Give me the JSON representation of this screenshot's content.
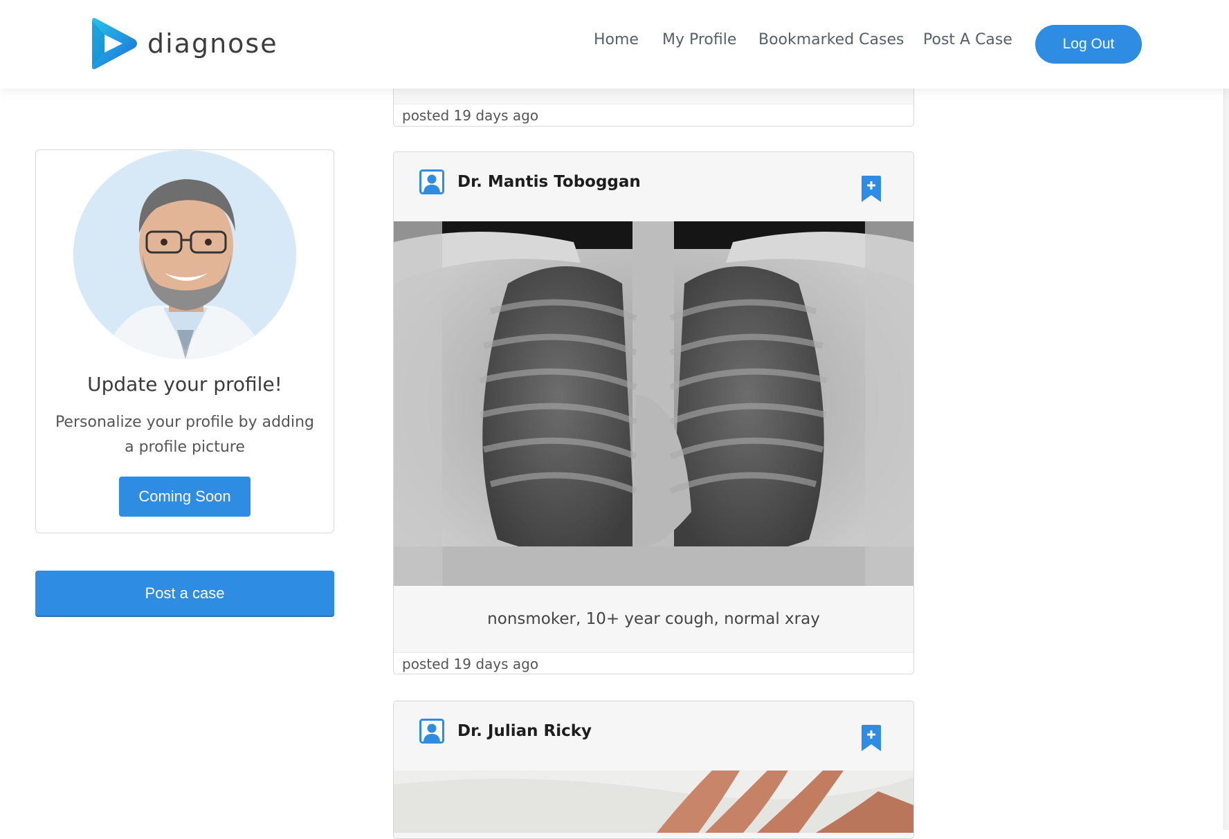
{
  "brand": {
    "name": "diagnose"
  },
  "nav": {
    "links": [
      "Home",
      "My Profile",
      "Bookmarked Cases",
      "Post A Case"
    ],
    "logout_label": "Log Out"
  },
  "profile_card": {
    "title": "Update your profile!",
    "description": "Personalize your profile by adding a profile picture",
    "button_label": "Coming Soon"
  },
  "sidebar": {
    "post_case_label": "Post a case"
  },
  "feed": {
    "previous_posted": "posted 19 days ago",
    "cases": [
      {
        "doctor": "Dr. Mantis Toboggan",
        "caption": "nonsmoker, 10+ year cough, normal xray",
        "posted": "posted 19 days ago"
      },
      {
        "doctor": "Dr. Julian Ricky"
      }
    ]
  },
  "colors": {
    "accent": "#2f8ce3",
    "card_bg": "#f6f6f6"
  },
  "icons": {
    "user": "user-profile-icon",
    "bookmark": "bookmark-plus-icon"
  }
}
